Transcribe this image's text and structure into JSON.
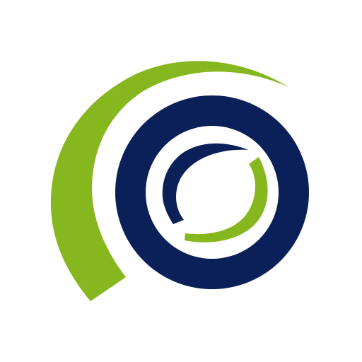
{
  "logo": {
    "icon": "spiral-ring-logo-icon",
    "colors": {
      "background": "#ffffff",
      "green": "#86B71F",
      "navy": "#0B2058"
    }
  }
}
